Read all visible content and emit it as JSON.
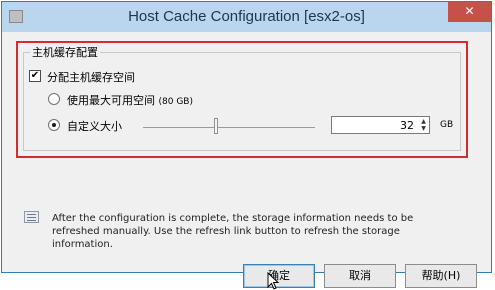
{
  "window": {
    "title": "Host Cache Configuration [esx2-os]",
    "close_label": "✕"
  },
  "group": {
    "legend": "主机缓存配置",
    "allocate_checkbox": {
      "label": "分配主机缓存空间",
      "checked": true,
      "mark": "✔"
    },
    "option_max": {
      "label": "使用最大可用空间",
      "detail": "(80 GB)",
      "selected": false
    },
    "option_custom": {
      "label": "自定义大小",
      "selected": true
    },
    "size_value": "32",
    "size_unit": "GB",
    "spin_up": "▲",
    "spin_down": "▼"
  },
  "info": {
    "text": "After the configuration is complete, the storage information needs to be refreshed manually. Use the refresh link button to refresh the storage information."
  },
  "buttons": {
    "ok": "确定",
    "cancel": "取消",
    "help": "帮助(H)"
  },
  "colors": {
    "title_bar": "#b9d6ee",
    "close_button": "#c7504a",
    "highlight_box": "#d42b2b"
  }
}
